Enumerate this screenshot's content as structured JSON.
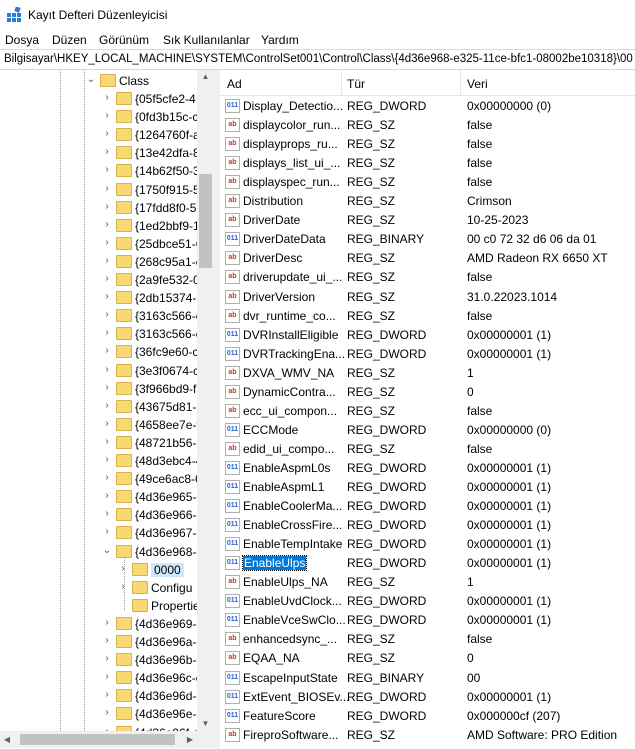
{
  "window": {
    "title": "Kayıt Defteri Düzenleyicisi",
    "icon": "registry-editor-icon"
  },
  "menu": [
    "Dosya",
    "Düzen",
    "Görünüm",
    "Sık Kullanılanlar",
    "Yardım"
  ],
  "address": "Bilgisayar\\HKEY_LOCAL_MACHINE\\SYSTEM\\ControlSet001\\Control\\Class\\{4d36e968-e325-11ce-bfc1-08002be10318}\\00",
  "tree": {
    "root_label": "Class",
    "items": [
      "{05f5cfe2-4",
      "{0fd3b15c-c",
      "{1264760f-a",
      "{13e42dfa-8",
      "{14b62f50-3",
      "{1750f915-5",
      "{17fdd8f0-5",
      "{1ed2bbf9-1",
      "{25dbce51-6",
      "{268c95a1-e",
      "{2a9fe532-0",
      "{2db15374-7",
      "{3163c566-c",
      "{3163c566-c",
      "{36fc9e60-c",
      "{3e3f0674-c",
      "{3f966bd9-f",
      "{43675d81-5",
      "{4658ee7e-f",
      "{48721b56-6",
      "{48d3ebc4-4",
      "{49ce6ac8-6",
      "{4d36e965-e",
      "{4d36e966-e",
      "{4d36e967-e",
      "{4d36e968-e"
    ],
    "expanded_children": [
      "0000",
      "Configu",
      "Propertie"
    ],
    "after_items": [
      "{4d36e969-e",
      "{4d36e96a-e",
      "{4d36e96b-e",
      "{4d36e96c-e",
      "{4d36e96d-e",
      "{4d36e96e-e",
      "{4d36e96f-e"
    ]
  },
  "columns": {
    "name": "Ad",
    "type": "Tür",
    "data": "Veri"
  },
  "values": [
    {
      "name": "Display_Detectio...",
      "type": "REG_DWORD",
      "data": "0x00000000 (0)",
      "icon": "dword"
    },
    {
      "name": "displaycolor_run...",
      "type": "REG_SZ",
      "data": "false",
      "icon": "sz"
    },
    {
      "name": "displayprops_ru...",
      "type": "REG_SZ",
      "data": "false",
      "icon": "sz"
    },
    {
      "name": "displays_list_ui_...",
      "type": "REG_SZ",
      "data": "false",
      "icon": "sz"
    },
    {
      "name": "displayspec_run...",
      "type": "REG_SZ",
      "data": "false",
      "icon": "sz"
    },
    {
      "name": "Distribution",
      "type": "REG_SZ",
      "data": "Crimson",
      "icon": "sz"
    },
    {
      "name": "DriverDate",
      "type": "REG_SZ",
      "data": "10-25-2023",
      "icon": "sz"
    },
    {
      "name": "DriverDateData",
      "type": "REG_BINARY",
      "data": "00 c0 72 32 d6 06 da 01",
      "icon": "dword"
    },
    {
      "name": "DriverDesc",
      "type": "REG_SZ",
      "data": "AMD Radeon RX 6650 XT",
      "icon": "sz"
    },
    {
      "name": "driverupdate_ui_...",
      "type": "REG_SZ",
      "data": "false",
      "icon": "sz"
    },
    {
      "name": "DriverVersion",
      "type": "REG_SZ",
      "data": "31.0.22023.1014",
      "icon": "sz"
    },
    {
      "name": "dvr_runtime_co...",
      "type": "REG_SZ",
      "data": "false",
      "icon": "sz"
    },
    {
      "name": "DVRInstallEligible",
      "type": "REG_DWORD",
      "data": "0x00000001 (1)",
      "icon": "dword"
    },
    {
      "name": "DVRTrackingEna...",
      "type": "REG_DWORD",
      "data": "0x00000001 (1)",
      "icon": "dword"
    },
    {
      "name": "DXVA_WMV_NA",
      "type": "REG_SZ",
      "data": "1",
      "icon": "sz"
    },
    {
      "name": "DynamicContra...",
      "type": "REG_SZ",
      "data": "0",
      "icon": "sz"
    },
    {
      "name": "ecc_ui_compon...",
      "type": "REG_SZ",
      "data": "false",
      "icon": "sz"
    },
    {
      "name": "ECCMode",
      "type": "REG_DWORD",
      "data": "0x00000000 (0)",
      "icon": "dword"
    },
    {
      "name": "edid_ui_compo...",
      "type": "REG_SZ",
      "data": "false",
      "icon": "sz"
    },
    {
      "name": "EnableAspmL0s",
      "type": "REG_DWORD",
      "data": "0x00000001 (1)",
      "icon": "dword"
    },
    {
      "name": "EnableAspmL1",
      "type": "REG_DWORD",
      "data": "0x00000001 (1)",
      "icon": "dword"
    },
    {
      "name": "EnableCoolerMa...",
      "type": "REG_DWORD",
      "data": "0x00000001 (1)",
      "icon": "dword"
    },
    {
      "name": "EnableCrossFire...",
      "type": "REG_DWORD",
      "data": "0x00000001 (1)",
      "icon": "dword"
    },
    {
      "name": "EnableTempIntake",
      "type": "REG_DWORD",
      "data": "0x00000001 (1)",
      "icon": "dword"
    },
    {
      "name": "EnableUlps",
      "type": "REG_DWORD",
      "data": "0x00000001 (1)",
      "icon": "dword",
      "selected": true
    },
    {
      "name": "EnableUlps_NA",
      "type": "REG_SZ",
      "data": "1",
      "icon": "sz"
    },
    {
      "name": "EnableUvdClock...",
      "type": "REG_DWORD",
      "data": "0x00000001 (1)",
      "icon": "dword"
    },
    {
      "name": "EnableVceSwClo...",
      "type": "REG_DWORD",
      "data": "0x00000001 (1)",
      "icon": "dword"
    },
    {
      "name": "enhancedsync_...",
      "type": "REG_SZ",
      "data": "false",
      "icon": "sz"
    },
    {
      "name": "EQAA_NA",
      "type": "REG_SZ",
      "data": "0",
      "icon": "sz"
    },
    {
      "name": "EscapeInputState",
      "type": "REG_BINARY",
      "data": "00",
      "icon": "dword"
    },
    {
      "name": "ExtEvent_BIOSEv...",
      "type": "REG_DWORD",
      "data": "0x00000001 (1)",
      "icon": "dword"
    },
    {
      "name": "FeatureScore",
      "type": "REG_DWORD",
      "data": "0x000000cf (207)",
      "icon": "dword"
    },
    {
      "name": "FireproSoftware...",
      "type": "REG_SZ",
      "data": "AMD Software: PRO Edition",
      "icon": "sz"
    }
  ],
  "colors": {
    "selection": "#0078d7",
    "folder": "#f8d775",
    "sz_icon": "#c0392b",
    "bin_icon": "#2a62c9"
  }
}
